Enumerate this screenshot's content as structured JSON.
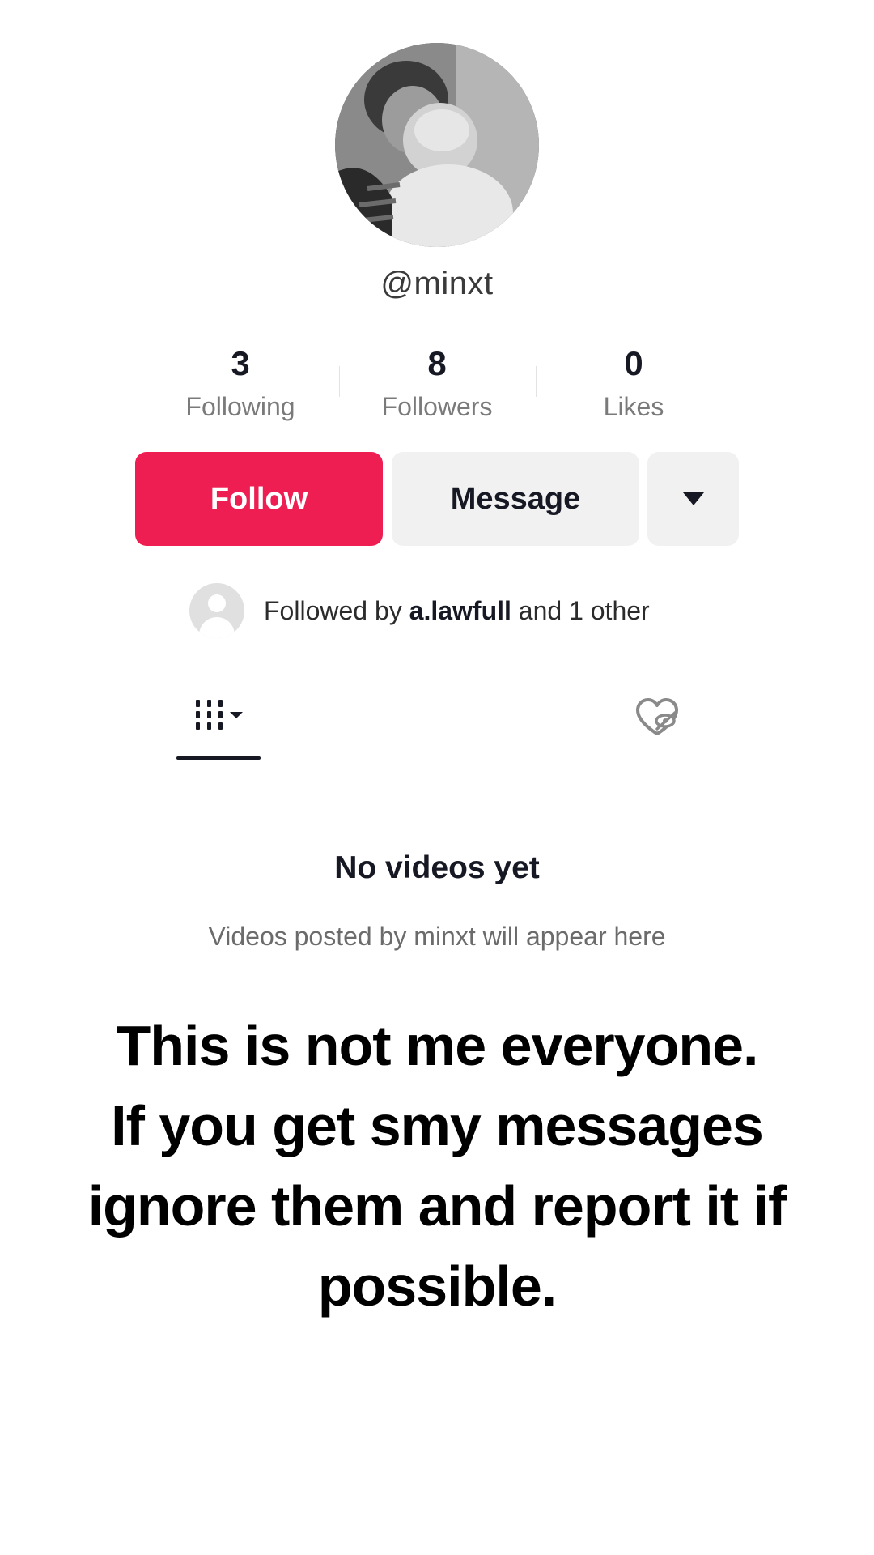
{
  "profile": {
    "username": "@minxt",
    "avatar_icon": "profile-photo"
  },
  "stats": [
    {
      "value": "3",
      "label": "Following"
    },
    {
      "value": "8",
      "label": "Followers"
    },
    {
      "value": "0",
      "label": "Likes"
    }
  ],
  "actions": {
    "follow_label": "Follow",
    "message_label": "Message",
    "more_icon": "triangle-down-icon"
  },
  "followed_by": {
    "prefix": "Followed by ",
    "user": "a.lawfull",
    "suffix": " and 1 other"
  },
  "tabs": {
    "videos_icon": "grid-dropdown-icon",
    "liked_icon": "hidden-heart-icon"
  },
  "empty_state": {
    "title": "No videos yet",
    "subtitle": "Videos posted by minxt will appear here"
  },
  "overlay_message": {
    "lines": [
      "This is not me everyone.",
      "If you get smy messages",
      "ignore them and report it if",
      "possible."
    ]
  },
  "colors": {
    "follow": "#ee1d52",
    "secondary_button": "#f1f1f2",
    "text_primary": "#161823",
    "text_secondary": "#7a7a7a"
  }
}
